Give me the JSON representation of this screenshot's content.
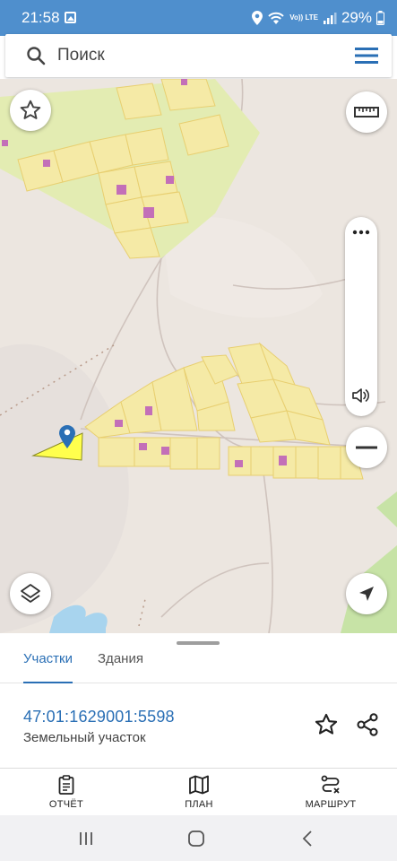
{
  "status_bar": {
    "time": "21:58",
    "battery": "29%",
    "network": "Vo)) LTE",
    "icons": [
      "image-icon",
      "location-icon",
      "wifi-icon",
      "signal-icon",
      "battery-icon"
    ]
  },
  "search": {
    "placeholder": "Поиск"
  },
  "map": {
    "buttons": [
      "favorite-icon",
      "ruler-icon",
      "layers-icon",
      "locate-icon",
      "zoom-out-icon",
      "more-icon",
      "sound-icon"
    ],
    "colors": {
      "background": "#ece6e0",
      "parcel_fill": "#f5eaa6",
      "parcel_stroke": "#e8cf70",
      "field_green": "#dde9a4",
      "building": "#c36fb8",
      "selected_parcel": "#ffff4d",
      "water": "#a8d4ee",
      "forest": "#c7e3a6",
      "marker": "#2a6fb5"
    }
  },
  "sheet": {
    "tabs": [
      {
        "label": "Участки",
        "active": true
      },
      {
        "label": "Здания",
        "active": false
      }
    ],
    "parcel": {
      "number": "47:01:1629001:5598",
      "type": "Земельный участок"
    }
  },
  "actions": {
    "report": "ОТЧЁТ",
    "plan": "ПЛАН",
    "route": "МАРШРУТ"
  },
  "colors": {
    "accent": "#2a6fb5",
    "status_bar": "#4f8fcd"
  }
}
